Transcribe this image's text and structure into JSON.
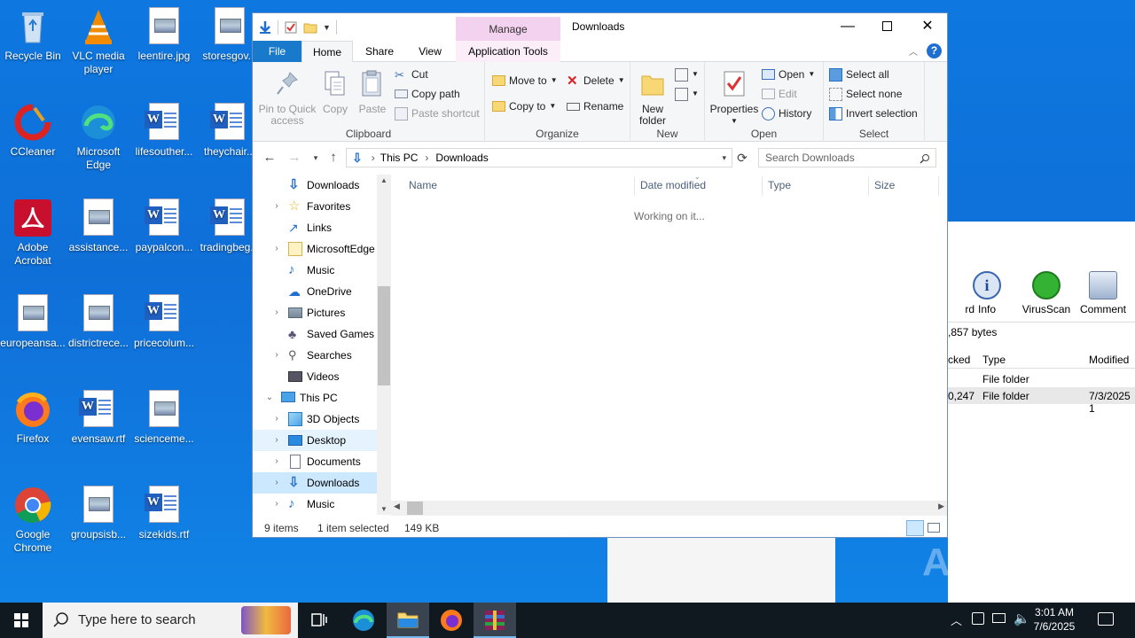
{
  "desktop": {
    "icons": [
      {
        "label": "Recycle Bin"
      },
      {
        "label": "VLC media player"
      },
      {
        "label": "leentire.jpg"
      },
      {
        "label": "storesgov..."
      },
      {
        "label": "CCleaner"
      },
      {
        "label": "Microsoft Edge"
      },
      {
        "label": "lifesouther..."
      },
      {
        "label": "theychair..."
      },
      {
        "label": "Adobe Acrobat"
      },
      {
        "label": "assistance..."
      },
      {
        "label": "paypalcon..."
      },
      {
        "label": "tradingbeg..."
      },
      {
        "label": "europeansa..."
      },
      {
        "label": "districtrece..."
      },
      {
        "label": "pricecolum..."
      },
      {
        "label": "Firefox"
      },
      {
        "label": "evensaw.rtf"
      },
      {
        "label": "scienceme..."
      },
      {
        "label": "Google Chrome"
      },
      {
        "label": "groupsisb..."
      },
      {
        "label": "sizekids.rtf"
      }
    ]
  },
  "bg_window": {
    "toolbar": [
      {
        "label": "rd"
      },
      {
        "label": "Info"
      },
      {
        "label": "VirusScan"
      },
      {
        "label": "Comment"
      }
    ],
    "info_text": ",857 bytes",
    "columns": [
      "cked",
      "Type",
      "Modified"
    ],
    "rows": [
      {
        "packed": "",
        "type": "File folder",
        "modified": ""
      },
      {
        "packed": "0,247",
        "type": "File folder",
        "modified": "7/3/2025 1"
      }
    ]
  },
  "watermark": "ANY RUN",
  "explorer": {
    "title": "Downloads",
    "manage_label": "Manage",
    "tabs": {
      "file": "File",
      "home": "Home",
      "share": "Share",
      "view": "View",
      "app_tools": "Application Tools"
    },
    "ribbon": {
      "clipboard": {
        "label": "Clipboard",
        "pin": "Pin to Quick access",
        "copy": "Copy",
        "paste": "Paste",
        "cut": "Cut",
        "copy_path": "Copy path",
        "paste_shortcut": "Paste shortcut"
      },
      "organize": {
        "label": "Organize",
        "move_to": "Move to",
        "copy_to": "Copy to",
        "delete": "Delete",
        "rename": "Rename"
      },
      "new": {
        "label": "New",
        "new_folder": "New folder"
      },
      "open": {
        "label": "Open",
        "properties": "Properties",
        "open": "Open",
        "edit": "Edit",
        "history": "History"
      },
      "select": {
        "label": "Select",
        "select_all": "Select all",
        "select_none": "Select none",
        "invert": "Invert selection"
      }
    },
    "address": {
      "segments": [
        "This PC",
        "Downloads"
      ],
      "search_placeholder": "Search Downloads"
    },
    "nav_items": [
      {
        "label": "Downloads"
      },
      {
        "label": "Favorites"
      },
      {
        "label": "Links"
      },
      {
        "label": "MicrosoftEdge"
      },
      {
        "label": "Music"
      },
      {
        "label": "OneDrive"
      },
      {
        "label": "Pictures"
      },
      {
        "label": "Saved Games"
      },
      {
        "label": "Searches"
      },
      {
        "label": "Videos"
      },
      {
        "label": "This PC"
      },
      {
        "label": "3D Objects"
      },
      {
        "label": "Desktop"
      },
      {
        "label": "Documents"
      },
      {
        "label": "Downloads"
      },
      {
        "label": "Music"
      }
    ],
    "columns": {
      "name": "Name",
      "date": "Date modified",
      "type": "Type",
      "size": "Size"
    },
    "working_text": "Working on it...",
    "status": {
      "count": "9 items",
      "selected": "1 item selected",
      "size": "149 KB"
    }
  },
  "taskbar": {
    "search_placeholder": "Type here to search",
    "time": "3:01 AM",
    "date": "7/6/2025"
  },
  "colors": {
    "accent": "#1979ca",
    "desktop": "#0f6fd8",
    "taskbar": "#101820"
  }
}
